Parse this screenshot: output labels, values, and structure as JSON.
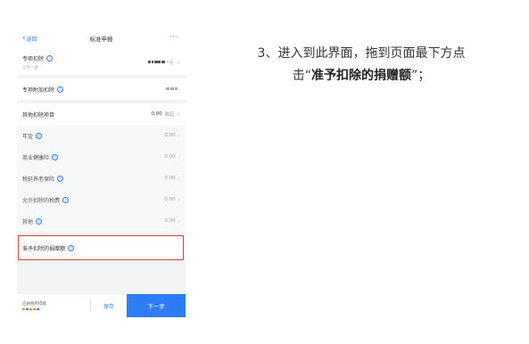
{
  "phone": {
    "nav": {
      "back_label": "返回",
      "title": "标准申报",
      "more_label": "···"
    },
    "special": {
      "label": "专项扣除",
      "note": "三险一金",
      "value_suffix": "*元"
    },
    "additional": {
      "label": "专项附加扣除"
    },
    "other": {
      "label": "其他扣除项目",
      "amount": "0.00",
      "toggle": "收起",
      "items": [
        {
          "label": "年金",
          "value": "0.00"
        },
        {
          "label": "商业健康险",
          "value": "0.00"
        },
        {
          "label": "税延养老保险",
          "value": "0.00"
        },
        {
          "label": "允许扣除的税费",
          "value": "0.00"
        },
        {
          "label": "其他",
          "value": "0.00"
        }
      ]
    },
    "donation": {
      "label": "准予扣除的捐赠额"
    },
    "bottom": {
      "brand_text": "应纳税所得额",
      "save_label": "保存",
      "next_label": "下一步"
    },
    "colors": {
      "accent": "#2e7cf6",
      "highlight": "#d9413b"
    }
  },
  "instruction": {
    "line1": "3、进入到此界面，拖到页面最下方点",
    "line2_prefix": "击“",
    "line2_bold": "准予扣除的捐赠额",
    "line2_suffix": "”；"
  }
}
